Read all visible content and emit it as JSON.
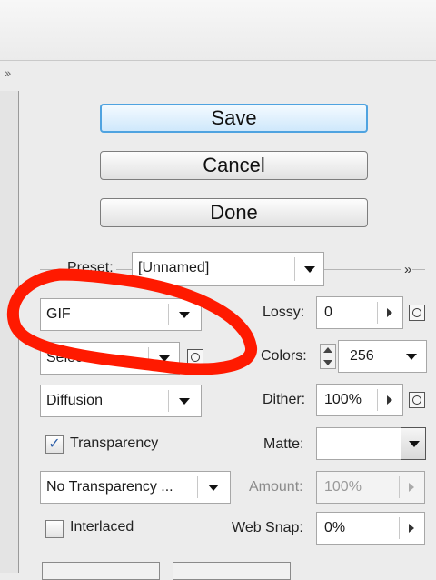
{
  "buttons": {
    "save": "Save",
    "cancel": "Cancel",
    "done": "Done"
  },
  "preset": {
    "label": "Preset:",
    "value": "[Unnamed]"
  },
  "format": {
    "value": "GIF"
  },
  "reduction": {
    "value": "Selective"
  },
  "dither_algorithm": {
    "value": "Diffusion"
  },
  "transparency": {
    "label": "Transparency",
    "checked": true
  },
  "transparency_dither": {
    "value": "No Transparency ..."
  },
  "interlaced": {
    "label": "Interlaced",
    "checked": false
  },
  "lossy": {
    "label": "Lossy:",
    "value": "0"
  },
  "colors": {
    "label": "Colors:",
    "value": "256"
  },
  "dither": {
    "label": "Dither:",
    "value": "100%"
  },
  "matte": {
    "label": "Matte:",
    "value": ""
  },
  "amount": {
    "label": "Amount:",
    "value": "100%"
  },
  "web_snap": {
    "label": "Web Snap:",
    "value": "0%"
  },
  "icons": {
    "expander": "double-chevron-right-icon",
    "circle_button": "eye-circle-icon",
    "dropdown": "chevron-down-icon",
    "slider_popup": "triangle-right-icon"
  },
  "colors_theme": {
    "save_border": "#4fa3e0",
    "annotation": "#ff1a00",
    "panel": "#ececec"
  }
}
